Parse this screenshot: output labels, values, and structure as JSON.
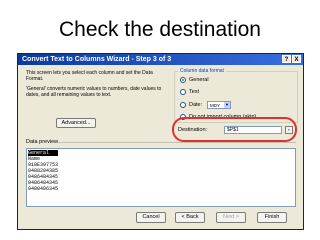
{
  "slide": {
    "title": "Check the destination"
  },
  "dialog": {
    "title": "Convert Text to Columns Wizard - Step 3 of 3",
    "help_glyph": "?",
    "close_glyph": "X",
    "intro_1": "This screen lets you select each column and set the Data Format.",
    "intro_2": "'General' converts numeric values to numbers, date values to dates, and all remaining values to text.",
    "advanced_label": "Advanced...",
    "column_format": {
      "legend": "Column data format",
      "options": [
        "General",
        "Text",
        "Date:",
        "Do not import column (skip)"
      ],
      "selected": "General",
      "date_value": "MDY"
    },
    "destination": {
      "label": "Destination:",
      "value": "$P$1"
    },
    "preview": {
      "label": "Data preview",
      "header": "General",
      "rows": [
        "Name",
        "018E397753",
        "0488294385",
        "0486484345",
        "0486484345",
        "0488486345"
      ]
    },
    "buttons": {
      "cancel": "Cancel",
      "back": "< Back",
      "next": "Next >",
      "finish": "Finish"
    }
  },
  "colors": {
    "titlebar": "#0a3a9b",
    "highlight": "#e03030",
    "dialog_bg": "#ece9d8"
  }
}
